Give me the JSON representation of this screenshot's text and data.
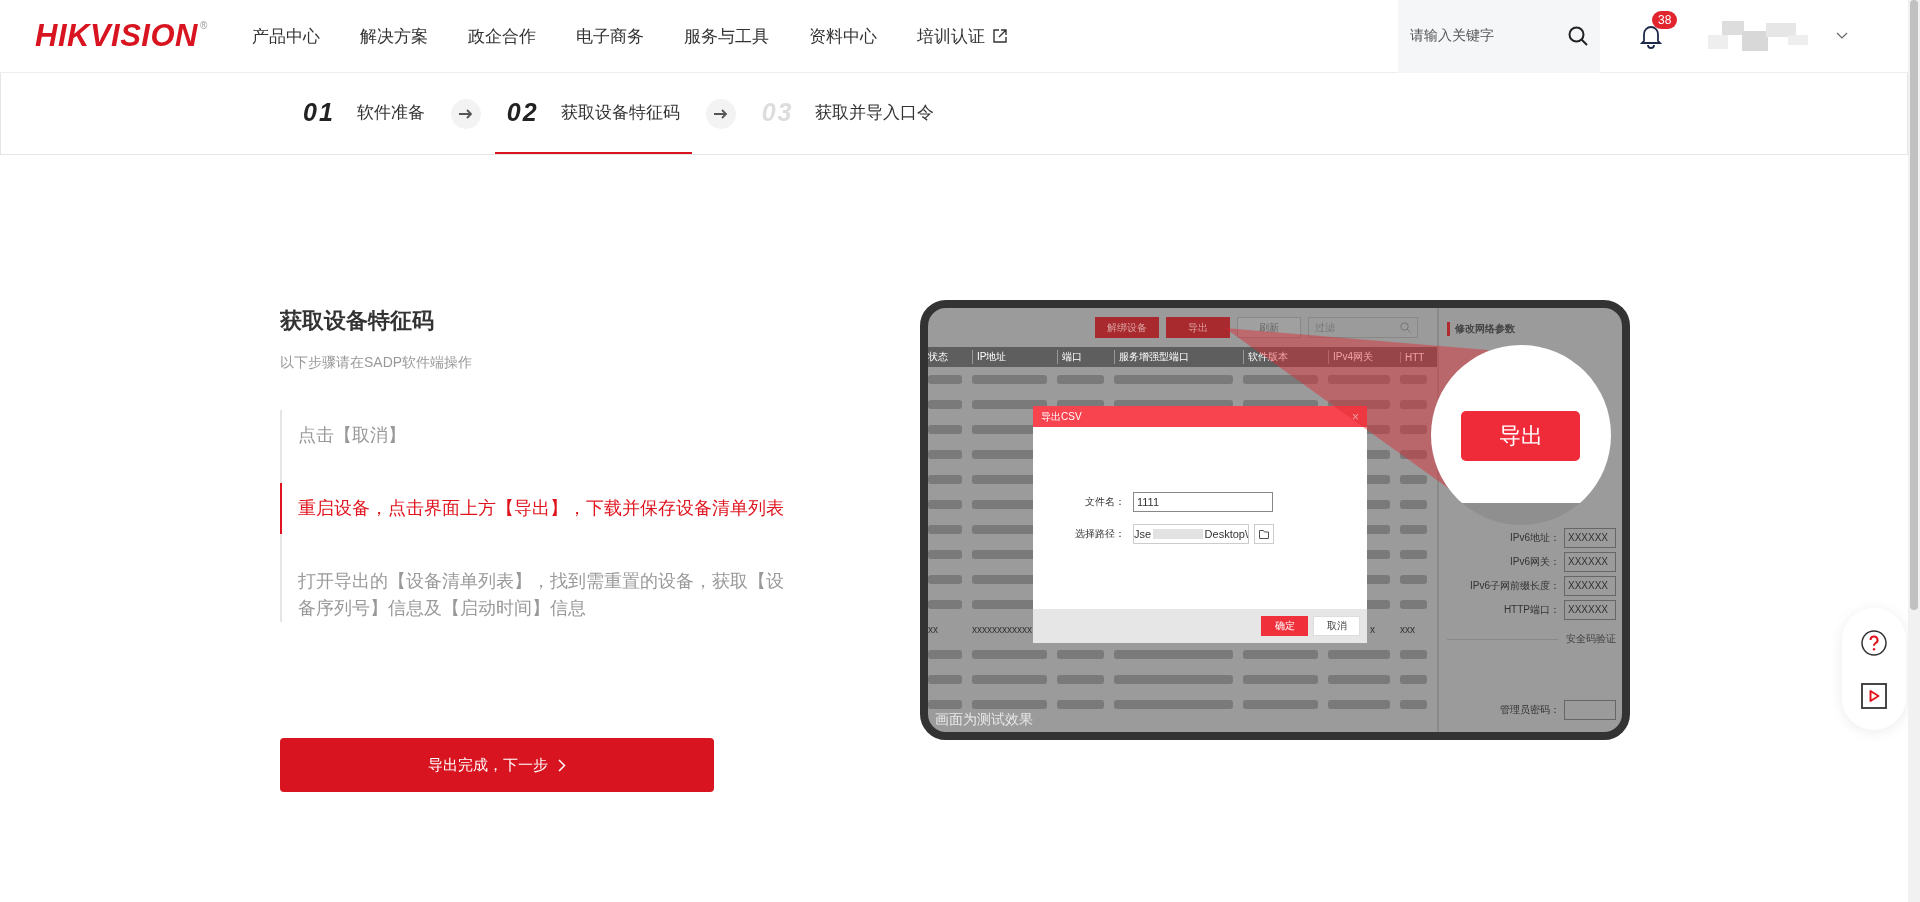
{
  "header": {
    "logo": "HIKVISION",
    "logo_mark": "®",
    "nav": [
      {
        "label": "产品中心",
        "external": false
      },
      {
        "label": "解决方案",
        "external": false
      },
      {
        "label": "政企合作",
        "external": false
      },
      {
        "label": "电子商务",
        "external": false
      },
      {
        "label": "服务与工具",
        "external": false
      },
      {
        "label": "资料中心",
        "external": false
      },
      {
        "label": "培训认证",
        "external": true
      }
    ],
    "search": {
      "placeholder": "请输入关键字"
    },
    "notifications": {
      "badge": "38"
    }
  },
  "steps": [
    {
      "number": "01",
      "label": "软件准备",
      "selected": false,
      "reached": true
    },
    {
      "number": "02",
      "label": "获取设备特征码",
      "selected": true,
      "reached": true
    },
    {
      "number": "03",
      "label": "获取并导入口令",
      "selected": false,
      "reached": false
    }
  ],
  "guide": {
    "title": "获取设备特征码",
    "subtitle": "以下步骤请在SADP软件端操作",
    "items": [
      {
        "text": "点击【取消】",
        "selected": false
      },
      {
        "text": "重启设备，点击界面上方【导出】，下载并保存设备清单列表",
        "selected": true
      },
      {
        "text": "打开导出的【设备清单列表】，找到需重置的设备，获取【设备序列号】信息及【启动时间】信息",
        "selected": false
      }
    ],
    "next_button": "导出完成，下一步"
  },
  "preview": {
    "toolbar_buttons": [
      "解绑设备",
      "导出",
      "刷新"
    ],
    "filter_placeholder": "过滤",
    "columns": [
      "状态",
      "IP地址",
      "端口",
      "服务增强型端口",
      "软件版本",
      "IPv4网关",
      "HTT"
    ],
    "row_texts": [
      "xx",
      "xxxxxxxxxxxx",
      "x",
      "xxx"
    ],
    "dialog": {
      "title": "导出CSV",
      "close": "×",
      "file_label": "文件名：",
      "file_value": "1111",
      "path_label": "选择路径：",
      "path_start": "Jse",
      "path_end": "Desktop\\",
      "ok": "确定",
      "cancel": "取消"
    },
    "panel": {
      "heading": "修改网络参数",
      "fields": [
        {
          "label": "IPv6地址：",
          "value": "XXXXXX"
        },
        {
          "label": "IPv6网关：",
          "value": "XXXXXX"
        },
        {
          "label": "IPv6子网前缀长度：",
          "value": "XXXXXX"
        },
        {
          "label": "HTTP端口：",
          "value": "XXXXXX"
        }
      ],
      "divider_text": "安全码验证",
      "password_label": "管理员密码："
    },
    "magnified_button": "导出",
    "caption": "画面为测试效果"
  }
}
